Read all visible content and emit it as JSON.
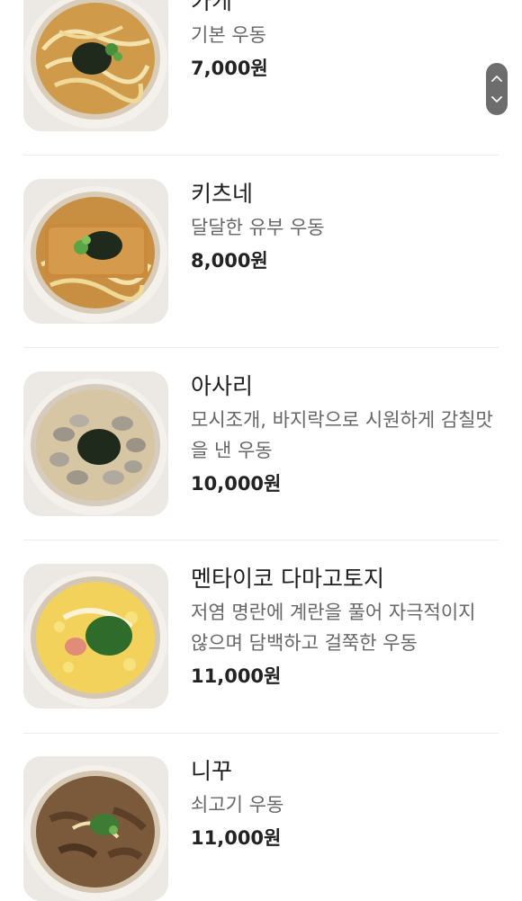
{
  "menu": {
    "items": [
      {
        "name": "카케",
        "description": "기본 우동",
        "price": "7,000원",
        "image": "udon-bowl-kake-icon"
      },
      {
        "name": "키츠네",
        "description": "달달한 유부 우동",
        "price": "8,000원",
        "image": "udon-bowl-kitsune-icon"
      },
      {
        "name": "아사리",
        "description": "모시조개, 바지락으로 시원하게 감칠맛을 낸 우동",
        "price": "10,000원",
        "image": "udon-bowl-asari-icon"
      },
      {
        "name": "멘타이코 다마고토지",
        "description": "저염 명란에 계란을 풀어 자극적이지 않으며 담백하고 걸쭉한 우동",
        "price": "11,000원",
        "image": "udon-bowl-mentaiko-icon"
      },
      {
        "name": "니꾸",
        "description": "쇠고기 우동",
        "price": "11,000원",
        "image": "udon-bowl-niku-icon"
      }
    ]
  },
  "scroll_control": {
    "up_icon": "chevron-up-icon",
    "down_icon": "chevron-down-icon"
  }
}
